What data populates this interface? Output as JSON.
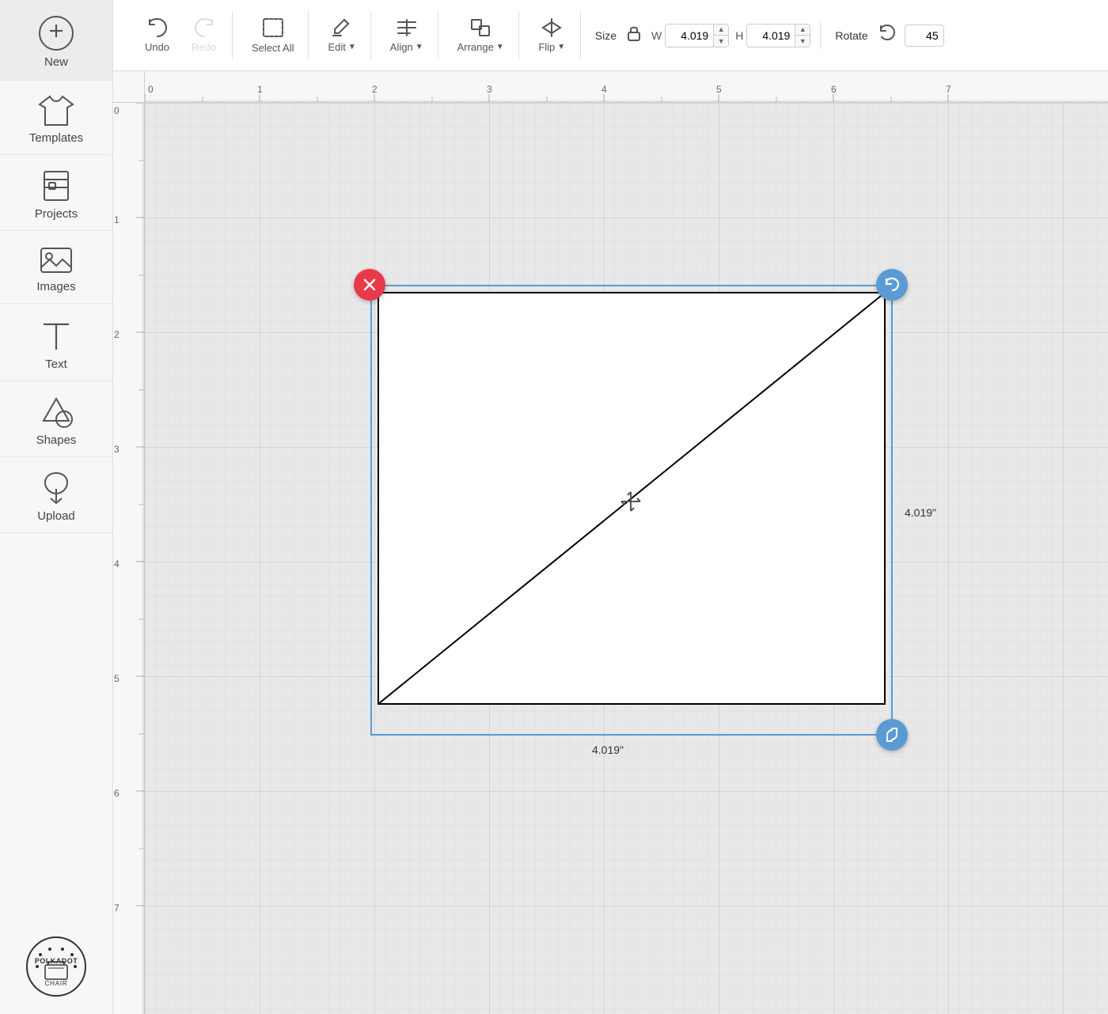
{
  "sidebar": {
    "items": [
      {
        "id": "new",
        "label": "New",
        "icon": "plus-circle"
      },
      {
        "id": "templates",
        "label": "Templates",
        "icon": "tshirt"
      },
      {
        "id": "projects",
        "label": "Projects",
        "icon": "bookmark"
      },
      {
        "id": "images",
        "label": "Images",
        "icon": "image"
      },
      {
        "id": "text",
        "label": "Text",
        "icon": "text-T"
      },
      {
        "id": "shapes",
        "label": "Shapes",
        "icon": "shapes"
      },
      {
        "id": "upload",
        "label": "Upload",
        "icon": "upload"
      }
    ],
    "logo": "Polkadot Chair"
  },
  "toolbar": {
    "undo_label": "Undo",
    "redo_label": "Redo",
    "select_all_label": "Select All",
    "edit_label": "Edit",
    "align_label": "Align",
    "arrange_label": "Arrange",
    "flip_label": "Flip",
    "size_label": "Size",
    "width_label": "W",
    "height_label": "H",
    "width_value": "4.019",
    "height_value": "4.019",
    "rotate_label": "Rotate",
    "rotate_value": "45"
  },
  "canvas": {
    "ruler_h_marks": [
      "0",
      "1",
      "2",
      "3",
      "4",
      "5",
      "6",
      "7"
    ],
    "ruler_v_marks": [
      "0",
      "1",
      "2",
      "3",
      "4",
      "5",
      "6",
      "7"
    ],
    "dim_width": "4.019\"",
    "dim_height": "4.019\""
  }
}
